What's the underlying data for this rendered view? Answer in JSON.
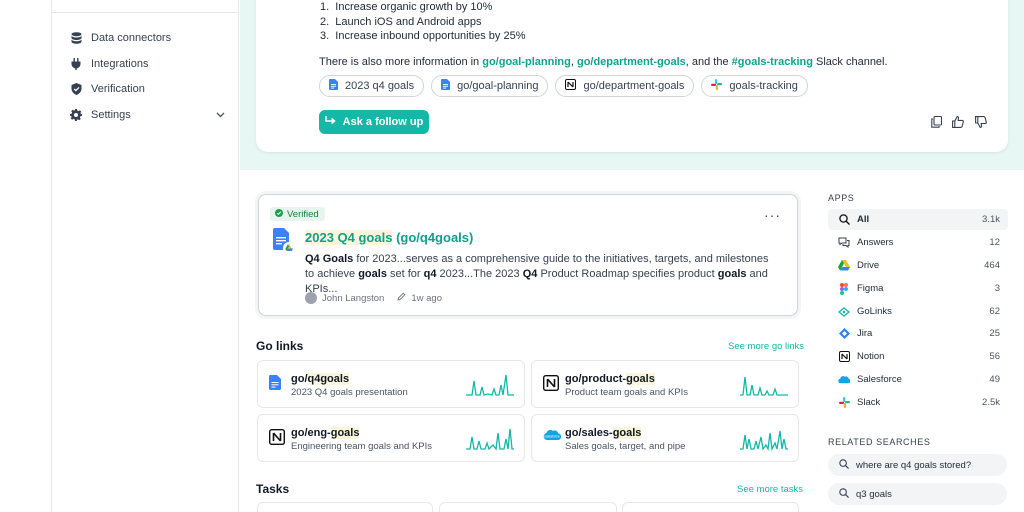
{
  "sidebar": {
    "items": [
      {
        "label": "Data connectors",
        "icon": "database-icon"
      },
      {
        "label": "Integrations",
        "icon": "plug-icon"
      },
      {
        "label": "Verification",
        "icon": "shield-check-icon"
      },
      {
        "label": "Settings",
        "icon": "gear-icon"
      }
    ]
  },
  "answer": {
    "list": [
      "Increase organic growth by 10%",
      "Launch iOS and Android apps",
      "Increase inbound opportunities by 25%"
    ],
    "more_prefix": "There is also more information in ",
    "link1": "go/goal-planning",
    "sep1": ", ",
    "link2": "go/department-goals",
    "sep2": ", and the ",
    "link3": "#goals-tracking",
    "more_suffix": " Slack channel.",
    "chips": [
      {
        "label": "2023 q4 goals",
        "icon": "google-docs-icon"
      },
      {
        "label": "go/goal-planning",
        "icon": "google-docs-icon"
      },
      {
        "label": "go/department-goals",
        "icon": "notion-icon"
      },
      {
        "label": "goals-tracking",
        "icon": "slack-icon"
      }
    ],
    "followup_label": "Ask a follow up"
  },
  "result": {
    "badge": "Verified",
    "title_hl": "2023 Q4 goals",
    "title_rest": " (go/q4goals)",
    "snippet": [
      {
        "t": "Q4 Goals",
        "b": true
      },
      {
        "t": " for 2023...serves as a comprehensive guide to the initiatives, targets, and milestones to achieve ",
        "b": false
      },
      {
        "t": "goals",
        "b": true
      },
      {
        "t": " set for ",
        "b": false
      },
      {
        "t": "q4",
        "b": true
      },
      {
        "t": " 2023...The 2023 ",
        "b": false
      },
      {
        "t": "Q4",
        "b": true
      },
      {
        "t": " Product Roadmap specifies product ",
        "b": false
      },
      {
        "t": "goals",
        "b": true
      },
      {
        "t": " and KPIs...",
        "b": false
      }
    ],
    "author": "John Langston",
    "time": "1w ago"
  },
  "golinks": {
    "title": "Go links",
    "see_more": "See more go links",
    "items": [
      {
        "prefix": "go/",
        "hl": "q4goals",
        "sub": "2023 Q4 goals presentation",
        "icon": "google-docs-icon"
      },
      {
        "prefix": "go/product-",
        "hl": "goals",
        "sub": "Product team goals and KPIs",
        "icon": "notion-icon"
      },
      {
        "prefix": "go/eng-",
        "hl": "goals",
        "sub": "Engineering team goals and KPIs",
        "icon": "notion-icon"
      },
      {
        "prefix": "go/sales-",
        "hl": "goals",
        "sub": "Sales goals, target, and pipe",
        "icon": "salesforce-icon"
      }
    ]
  },
  "tasks": {
    "title": "Tasks",
    "see_more": "See more tasks"
  },
  "apps": {
    "heading": "APPS",
    "items": [
      {
        "label": "All",
        "count": "3.1k",
        "icon": "search-icon"
      },
      {
        "label": "Answers",
        "count": "12",
        "icon": "chat-icon"
      },
      {
        "label": "Drive",
        "count": "464",
        "icon": "google-drive-icon"
      },
      {
        "label": "Figma",
        "count": "3",
        "icon": "figma-icon"
      },
      {
        "label": "GoLinks",
        "count": "62",
        "icon": "golinks-icon"
      },
      {
        "label": "Jira",
        "count": "25",
        "icon": "jira-icon"
      },
      {
        "label": "Notion",
        "count": "56",
        "icon": "notion-icon"
      },
      {
        "label": "Salesforce",
        "count": "49",
        "icon": "salesforce-icon"
      },
      {
        "label": "Slack",
        "count": "2.5k",
        "icon": "slack-icon"
      }
    ]
  },
  "related": {
    "heading": "RELATED SEARCHES",
    "items": [
      "where are q4 goals stored?",
      "q3 goals"
    ]
  },
  "colors": {
    "accent": "#14b8a6",
    "link": "#0ea58f",
    "panel": "#e7f7f3"
  }
}
